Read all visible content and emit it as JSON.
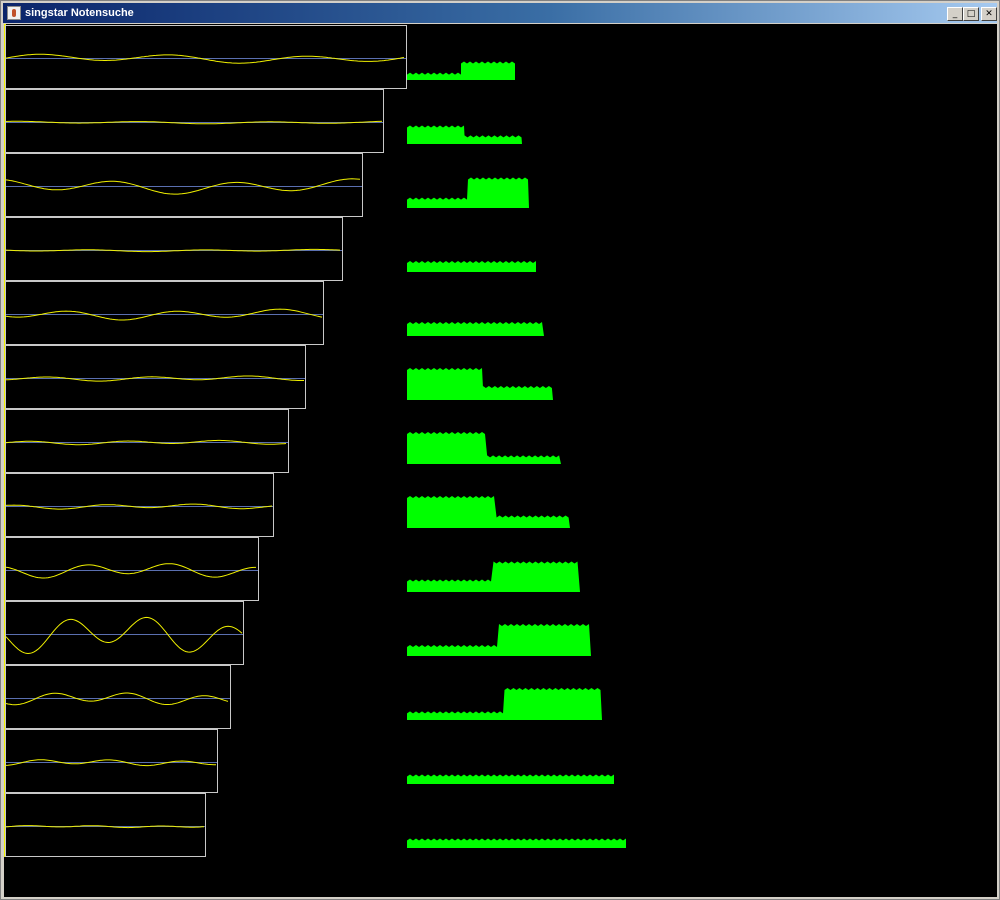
{
  "window": {
    "title": "singstar Notensuche",
    "controls": {
      "minimize": "_",
      "maximize": "□",
      "close": "✕"
    }
  },
  "colors": {
    "canvas": "#000000",
    "frame": "#c8c8c8",
    "baseline": "#5a6fb0",
    "waveform": "#f0f000",
    "spectrum": "#00ff00",
    "cursor": "#f0f000"
  },
  "chart_data": {
    "type": "other",
    "description_of_rows": "13 rows, each a waveform panel (left) and a spectrum bar (right)",
    "rows": [
      {
        "waveform_amp": 0.22,
        "spectrum_profile": [
          {
            "level": 0.18,
            "to": 0.5
          },
          {
            "level": 0.55,
            "to": 1.0
          }
        ]
      },
      {
        "waveform_amp": 0.06,
        "spectrum_profile": [
          {
            "level": 0.55,
            "to": 0.5
          },
          {
            "level": 0.22,
            "to": 1.0
          }
        ]
      },
      {
        "waveform_amp": 0.35,
        "spectrum_profile": [
          {
            "level": 0.28,
            "to": 0.5
          },
          {
            "level": 0.95,
            "to": 1.0
          }
        ]
      },
      {
        "waveform_amp": 0.05,
        "spectrum_profile": [
          {
            "level": 0.3,
            "to": 1.0
          }
        ]
      },
      {
        "waveform_amp": 0.25,
        "spectrum_profile": [
          {
            "level": 0.4,
            "to": 1.0
          }
        ]
      },
      {
        "waveform_amp": 0.12,
        "spectrum_profile": [
          {
            "level": 1.0,
            "to": 0.52
          },
          {
            "level": 0.4,
            "to": 1.0
          }
        ]
      },
      {
        "waveform_amp": 0.1,
        "spectrum_profile": [
          {
            "level": 1.0,
            "to": 0.52
          },
          {
            "level": 0.22,
            "to": 1.0
          }
        ]
      },
      {
        "waveform_amp": 0.12,
        "spectrum_profile": [
          {
            "level": 1.0,
            "to": 0.55
          },
          {
            "level": 0.35,
            "to": 1.0
          }
        ]
      },
      {
        "waveform_amp": 0.35,
        "spectrum_profile": [
          {
            "level": 0.35,
            "to": 0.5
          },
          {
            "level": 0.95,
            "to": 1.0
          }
        ]
      },
      {
        "waveform_amp": 0.9,
        "spectrum_profile": [
          {
            "level": 0.3,
            "to": 0.5
          },
          {
            "level": 1.0,
            "to": 1.0
          }
        ]
      },
      {
        "waveform_amp": 0.3,
        "spectrum_profile": [
          {
            "level": 0.22,
            "to": 0.5
          },
          {
            "level": 1.0,
            "to": 1.0
          }
        ]
      },
      {
        "waveform_amp": 0.15,
        "spectrum_profile": [
          {
            "level": 0.25,
            "to": 1.0
          }
        ]
      },
      {
        "waveform_amp": 0.05,
        "spectrum_profile": [
          {
            "level": 0.25,
            "to": 1.0
          }
        ]
      }
    ]
  }
}
